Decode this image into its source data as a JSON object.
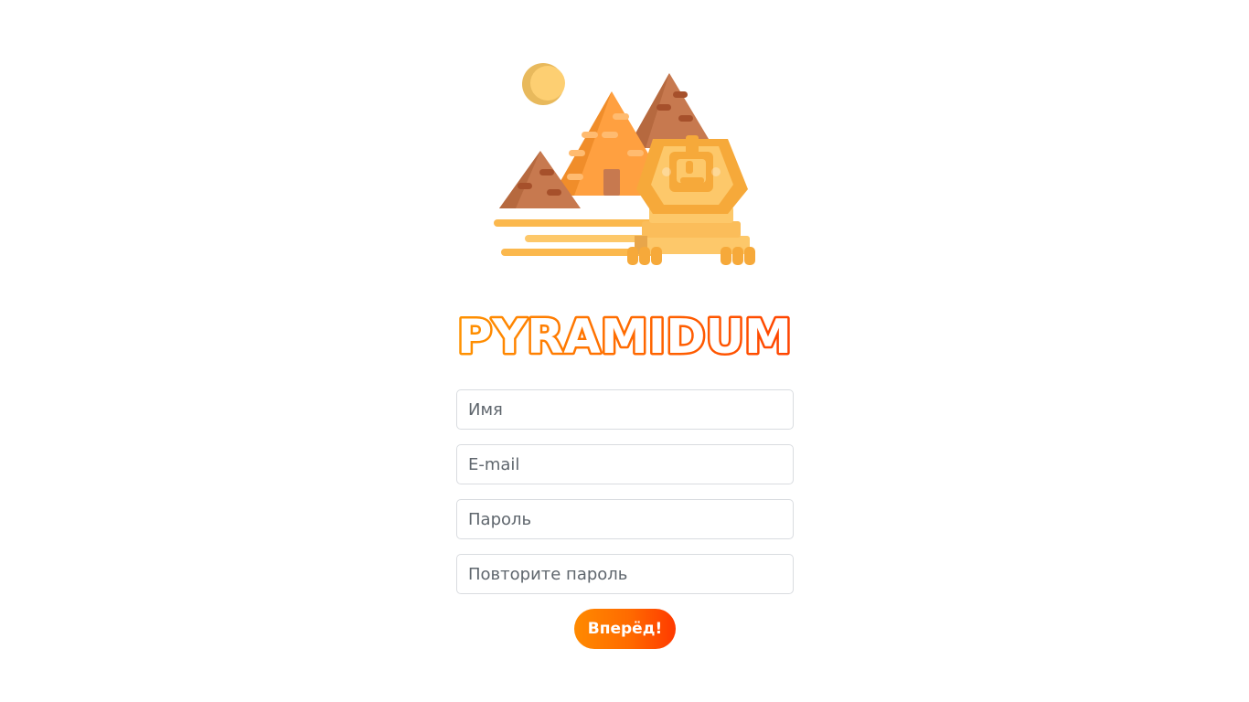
{
  "brand": {
    "name": "PYRAMIDUM",
    "illustration": "pyramids-sphinx-illustration",
    "colors": {
      "logo_gradient_start": "#ff9200",
      "logo_gradient_end": "#ff4400",
      "button_gradient_start": "#ff8a00",
      "button_gradient_end": "#ff3a00"
    }
  },
  "form": {
    "name_placeholder": "Имя",
    "email_placeholder": "E-mail",
    "password_placeholder": "Пароль",
    "password_repeat_placeholder": "Повторите пароль",
    "submit_label": "Вперёд!"
  }
}
